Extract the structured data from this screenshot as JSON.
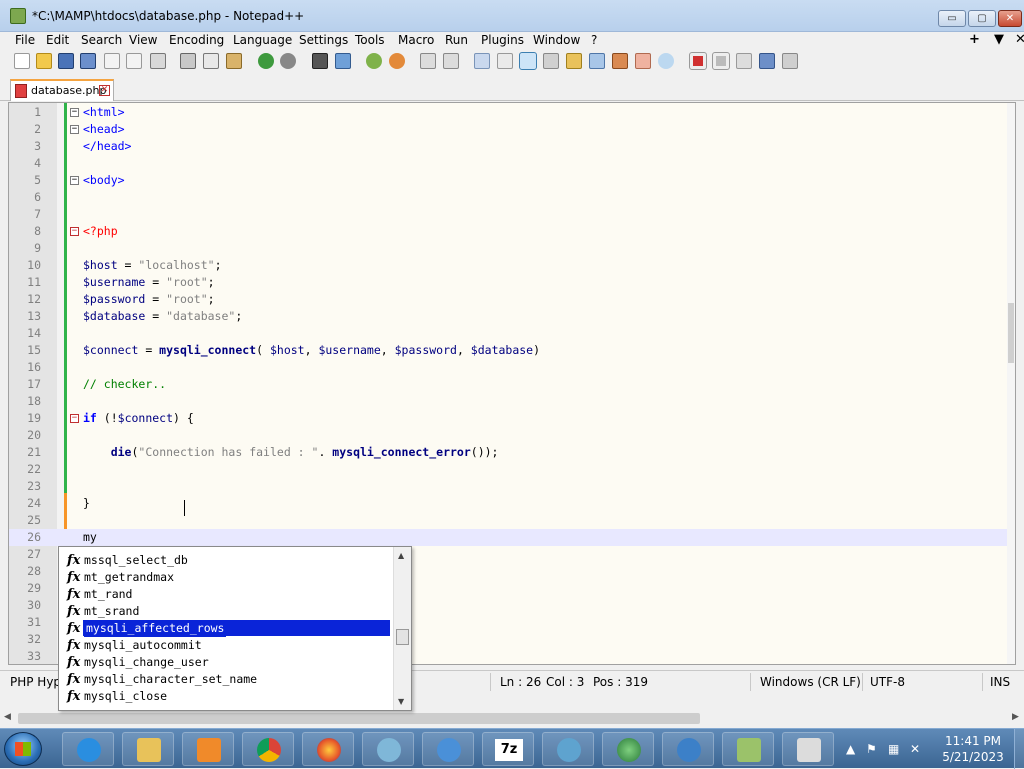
{
  "window": {
    "title": "*C:\\MAMP\\htdocs\\database.php - Notepad++",
    "minimize_label": "▭",
    "maximize_label": "▢",
    "close_label": "✕"
  },
  "menu": {
    "items": [
      "File",
      "Edit",
      "Search",
      "View",
      "Encoding",
      "Language",
      "Settings",
      "Tools",
      "Macro",
      "Run",
      "Plugins",
      "Window",
      "?"
    ],
    "right": [
      "+",
      "▼",
      "✕"
    ]
  },
  "toolbar": {
    "icons": [
      "new-file-icon",
      "open-file-icon",
      "save-icon",
      "save-all-icon",
      "close-icon",
      "close-all-icon",
      "print-icon",
      "cut-icon",
      "copy-icon",
      "paste-icon",
      "undo-icon",
      "redo-icon",
      "find-icon",
      "replace-icon",
      "zoom-in-icon",
      "zoom-out-icon",
      "sync-vertical-icon",
      "sync-horizontal-icon",
      "word-wrap-icon",
      "show-all-chars-icon",
      "indent-guide-icon",
      "user-language-icon",
      "document-map-icon",
      "function-list-icon",
      "folder-as-workspace-icon",
      "monitoring-icon",
      "record-macro-icon",
      "stop-macro-icon",
      "play-macro-icon",
      "run-macro-multiple-icon",
      "save-macro-icon"
    ]
  },
  "tab": {
    "label": "database.php",
    "close": "✕"
  },
  "editor": {
    "lines": [
      {
        "n": "1",
        "fold": "−",
        "code": [
          {
            "t": "<html>",
            "c": "tag"
          }
        ]
      },
      {
        "n": "2",
        "fold": "−",
        "code": [
          {
            "t": "<head>",
            "c": "tag"
          }
        ]
      },
      {
        "n": "3",
        "fold": "",
        "code": [
          {
            "t": "</head>",
            "c": "tag"
          }
        ]
      },
      {
        "n": "4",
        "fold": "",
        "code": []
      },
      {
        "n": "5",
        "fold": "−",
        "code": [
          {
            "t": "<body>",
            "c": "tag"
          }
        ]
      },
      {
        "n": "6",
        "fold": "",
        "code": []
      },
      {
        "n": "7",
        "fold": "",
        "code": []
      },
      {
        "n": "8",
        "fold": "−",
        "foldred": true,
        "code": [
          {
            "t": "<?php",
            "c": "php"
          }
        ]
      },
      {
        "n": "9",
        "fold": "",
        "code": []
      },
      {
        "n": "10",
        "fold": "",
        "code": [
          {
            "t": "$host",
            "c": "var"
          },
          {
            "t": " = ",
            "c": ""
          },
          {
            "t": "\"localhost\"",
            "c": "str"
          },
          {
            "t": ";",
            "c": ""
          }
        ]
      },
      {
        "n": "11",
        "fold": "",
        "code": [
          {
            "t": "$username",
            "c": "var"
          },
          {
            "t": " = ",
            "c": ""
          },
          {
            "t": "\"root\"",
            "c": "str"
          },
          {
            "t": ";",
            "c": ""
          }
        ]
      },
      {
        "n": "12",
        "fold": "",
        "code": [
          {
            "t": "$password",
            "c": "var"
          },
          {
            "t": " = ",
            "c": ""
          },
          {
            "t": "\"root\"",
            "c": "str"
          },
          {
            "t": ";",
            "c": ""
          }
        ]
      },
      {
        "n": "13",
        "fold": "",
        "code": [
          {
            "t": "$database",
            "c": "var"
          },
          {
            "t": " = ",
            "c": ""
          },
          {
            "t": "\"database\"",
            "c": "str"
          },
          {
            "t": ";",
            "c": ""
          }
        ]
      },
      {
        "n": "14",
        "fold": "",
        "code": []
      },
      {
        "n": "15",
        "fold": "",
        "code": [
          {
            "t": "$connect",
            "c": "var"
          },
          {
            "t": " = ",
            "c": ""
          },
          {
            "t": "mysqli_connect",
            "c": "fn"
          },
          {
            "t": "( ",
            "c": ""
          },
          {
            "t": "$host",
            "c": "var"
          },
          {
            "t": ", ",
            "c": ""
          },
          {
            "t": "$username",
            "c": "var"
          },
          {
            "t": ", ",
            "c": ""
          },
          {
            "t": "$password",
            "c": "var"
          },
          {
            "t": ", ",
            "c": ""
          },
          {
            "t": "$database",
            "c": "var"
          },
          {
            "t": ")",
            "c": ""
          }
        ]
      },
      {
        "n": "16",
        "fold": "",
        "code": []
      },
      {
        "n": "17",
        "fold": "",
        "code": [
          {
            "t": "// checker..",
            "c": "cmt"
          }
        ]
      },
      {
        "n": "18",
        "fold": "",
        "code": []
      },
      {
        "n": "19",
        "fold": "−",
        "foldred": true,
        "code": [
          {
            "t": "if",
            "c": "kw"
          },
          {
            "t": " (!",
            "c": ""
          },
          {
            "t": "$connect",
            "c": "var"
          },
          {
            "t": ") {",
            "c": ""
          }
        ]
      },
      {
        "n": "20",
        "fold": "",
        "code": []
      },
      {
        "n": "21",
        "fold": "",
        "code": [
          {
            "t": "    ",
            "c": ""
          },
          {
            "t": "die",
            "c": "fn"
          },
          {
            "t": "(",
            "c": ""
          },
          {
            "t": "\"Connection has failed : \"",
            "c": "str"
          },
          {
            "t": ". ",
            "c": ""
          },
          {
            "t": "mysqli_connect_error",
            "c": "fn"
          },
          {
            "t": "());",
            "c": ""
          }
        ]
      },
      {
        "n": "22",
        "fold": "",
        "code": []
      },
      {
        "n": "23",
        "fold": "",
        "code": []
      },
      {
        "n": "24",
        "fold": "",
        "code": [
          {
            "t": "}",
            "c": ""
          }
        ]
      },
      {
        "n": "25",
        "fold": "",
        "code": []
      },
      {
        "n": "26",
        "fold": "",
        "current": true,
        "code": [
          {
            "t": "my",
            "c": ""
          }
        ]
      },
      {
        "n": "27",
        "fold": "",
        "code": []
      },
      {
        "n": "28",
        "fold": "",
        "code": []
      },
      {
        "n": "29",
        "fold": "",
        "code": []
      },
      {
        "n": "30",
        "fold": "",
        "code": []
      },
      {
        "n": "31",
        "fold": "",
        "code": []
      },
      {
        "n": "32",
        "fold": "",
        "code": []
      },
      {
        "n": "33",
        "fold": "",
        "code": []
      }
    ]
  },
  "autocomplete": {
    "icon_label": "fx",
    "items": [
      "mssql_select_db",
      "mt_getrandmax",
      "mt_rand",
      "mt_srand",
      "mysqli_affected_rows",
      "mysqli_autocommit",
      "mysqli_change_user",
      "mysqli_character_set_name",
      "mysqli_close"
    ],
    "selected_index": 4
  },
  "statusbar": {
    "language": "PHP Hyp",
    "ln": "Ln : 26",
    "col": "Col : 3",
    "pos": "Pos : 319",
    "eol": "Windows (CR LF)",
    "encoding": "UTF-8",
    "mode": "INS"
  },
  "taskbar": {
    "apps": [
      "ie-icon",
      "file-explorer-icon",
      "media-player-icon",
      "chrome-icon",
      "firefox-icon",
      "mysql-dolphin-icon",
      "update-shield-icon",
      "7zip-icon",
      "mysql-workbench-icon",
      "network-globe-icon",
      "globe-shield-icon",
      "notepadpp-icon",
      "xampp-icon"
    ],
    "app_7zip_text": "7z",
    "time": "11:41 PM",
    "date": "5/21/2023"
  },
  "colors": {
    "tag": "#0000ff",
    "php_open": "#ff0000",
    "variable": "#000080",
    "string": "#808080",
    "comment": "#008000",
    "selection": "#0a24d8",
    "change_bar": "#2fb34a"
  }
}
